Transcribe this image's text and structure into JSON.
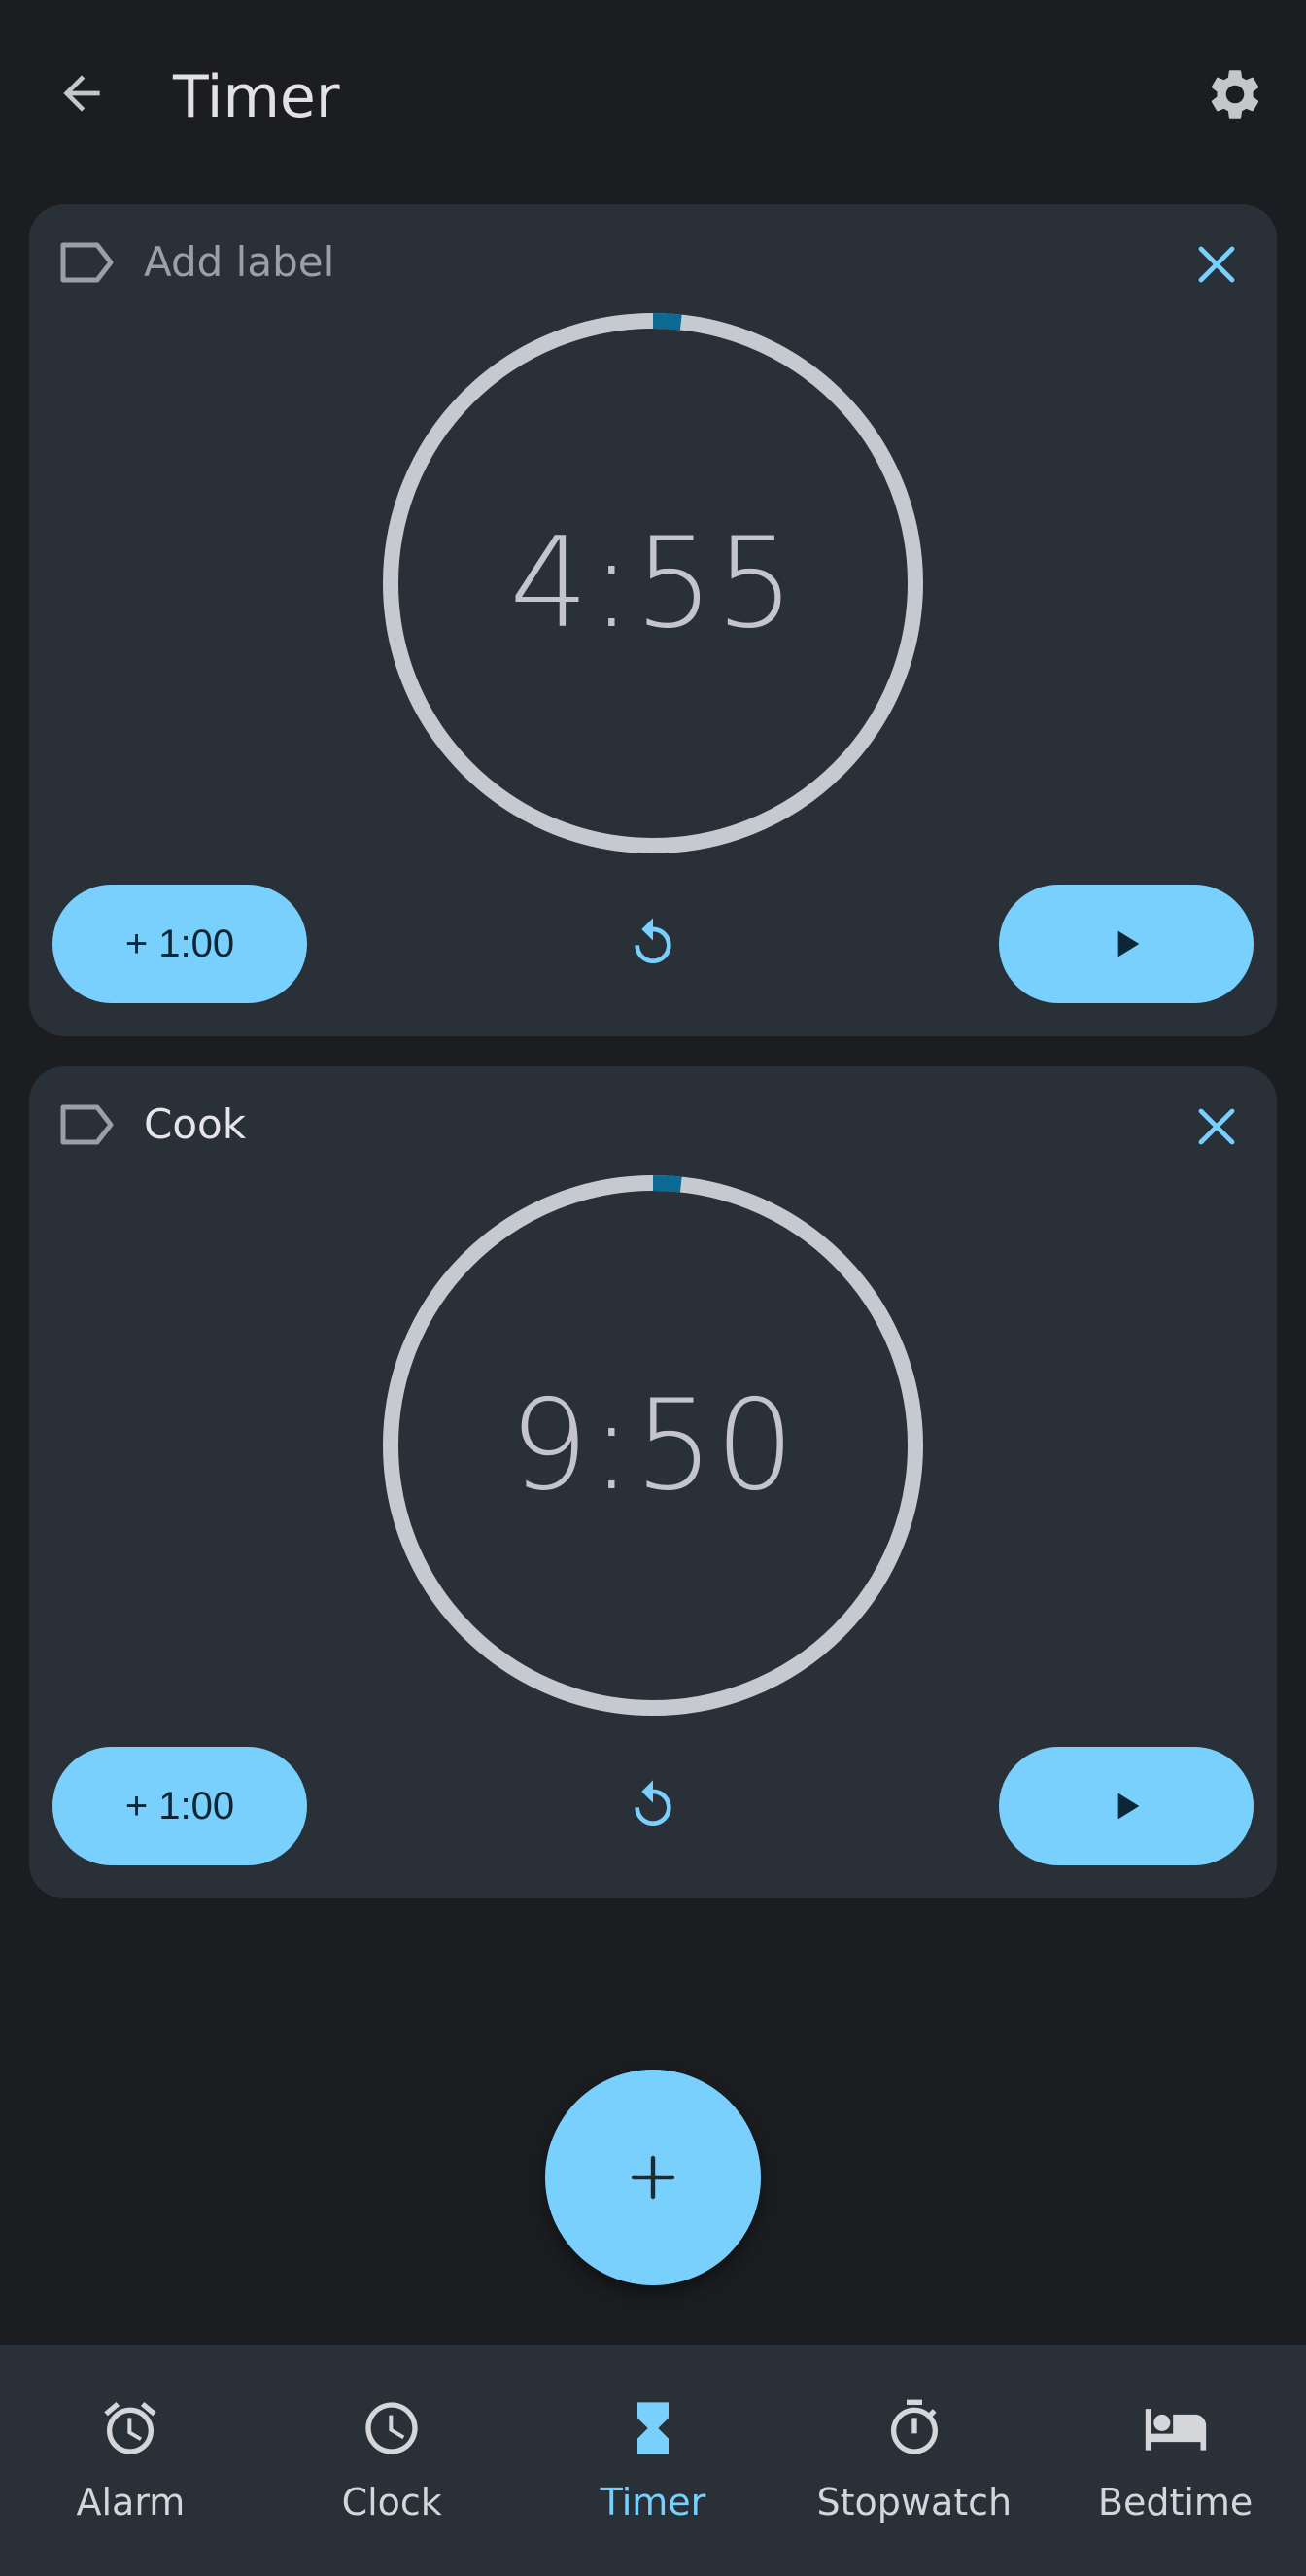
{
  "app_bar": {
    "title": "Timer",
    "back_icon": "arrow-back-icon",
    "settings_icon": "gear-icon"
  },
  "timers": [
    {
      "label": "Add label",
      "label_is_placeholder": true,
      "time": "4:55",
      "progress": 0.017,
      "add_minute_label": "+ 1:00",
      "state": "paused"
    },
    {
      "label": "Cook",
      "label_is_placeholder": false,
      "time": "9:50",
      "progress": 0.017,
      "add_minute_label": "+ 1:00",
      "state": "paused"
    }
  ],
  "fab": {
    "icon": "plus-icon"
  },
  "bottom_nav": {
    "items": [
      {
        "label": "Alarm",
        "icon": "alarm-icon",
        "active": false
      },
      {
        "label": "Clock",
        "icon": "clock-icon",
        "active": false
      },
      {
        "label": "Timer",
        "icon": "hourglass-icon",
        "active": true
      },
      {
        "label": "Stopwatch",
        "icon": "stopwatch-icon",
        "active": false
      },
      {
        "label": "Bedtime",
        "icon": "bed-icon",
        "active": false
      }
    ]
  },
  "colors": {
    "background": "#1b1d20",
    "surface": "#2a3038",
    "accent": "#79d0fd",
    "progress": "#0b6a94",
    "ring": "#c6cad0"
  }
}
